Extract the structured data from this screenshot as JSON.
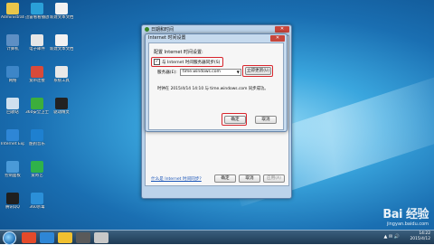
{
  "desktop_icons": [
    {
      "label": "Administrator",
      "color": "#e9c64a",
      "col": 0,
      "row": 0
    },
    {
      "label": "迅雷看看播放器",
      "color": "#2aa0d8",
      "col": 1,
      "row": 0
    },
    {
      "label": "新建文本文档",
      "color": "#f2f2f2",
      "col": 2,
      "row": 0
    },
    {
      "label": "计算机",
      "color": "#5d8fc4",
      "col": 0,
      "row": 1
    },
    {
      "label": "电子邮件",
      "color": "#e6e6e6",
      "col": 1,
      "row": 1
    },
    {
      "label": "新建文本文档",
      "color": "#f2f2f2",
      "col": 2,
      "row": 1
    },
    {
      "label": "网络",
      "color": "#3d86c8",
      "col": 0,
      "row": 2
    },
    {
      "label": "宽带连接",
      "color": "#d84a3a",
      "col": 1,
      "row": 2
    },
    {
      "label": "系统工具",
      "color": "#e8e8e8",
      "col": 2,
      "row": 2
    },
    {
      "label": "回收站",
      "color": "#cfe0ef",
      "col": 0,
      "row": 3
    },
    {
      "label": "360安全卫士",
      "color": "#3cae3c",
      "col": 1,
      "row": 3
    },
    {
      "label": "驱动精灵",
      "color": "#222222",
      "col": 2,
      "row": 3
    },
    {
      "label": "Internet Explorer",
      "color": "#2e86d6",
      "col": 0,
      "row": 4
    },
    {
      "label": "酷狗音乐",
      "color": "#1e80d0",
      "col": 1,
      "row": 4
    },
    {
      "label": "控制面板",
      "color": "#4a9ad8",
      "col": 0,
      "row": 5
    },
    {
      "label": "爱奇艺",
      "color": "#2fb24a",
      "col": 1,
      "row": 5
    },
    {
      "label": "腾讯QQ",
      "color": "#1f1f1f",
      "col": 0,
      "row": 6
    },
    {
      "label": "360杀毒",
      "color": "#2b8fd8",
      "col": 1,
      "row": 6
    }
  ],
  "outer_dialog": {
    "title": "日期和时间",
    "close": "✕",
    "link": "什么是 Internet 时间同步?",
    "buttons": [
      "确定",
      "取消",
      "应用(A)"
    ]
  },
  "inner_dialog": {
    "title": "Internet 时间设置",
    "close": "✕",
    "heading": "配置 Internet 时间设置:",
    "checkbox_label": "与 Internet 时间服务器同步(S)",
    "checkbox_checked": "✓",
    "server_label": "服务器(E):",
    "server_value": "time.windows.com",
    "update_button": "立即更新(U)",
    "sync_status": "时钟在 2015/4/14 14:10 与 time.windows.com 同步成功。",
    "ok_button": "确定",
    "cancel_button": "取消"
  },
  "taskbar": {
    "time": "14:22",
    "date": "2015/4/12",
    "tray": "▲ ✉ 🔊",
    "items": [
      "#e44a2a",
      "#2e86d6",
      "#f0c030",
      "#5a5a5a",
      "#c8c8c8"
    ]
  },
  "watermark": {
    "brand": "Bai 经验",
    "url": "jingyan.baidu.com"
  },
  "colors": {
    "highlight_red": "#d8252c",
    "desktop_blue": "#1a6fb2"
  }
}
